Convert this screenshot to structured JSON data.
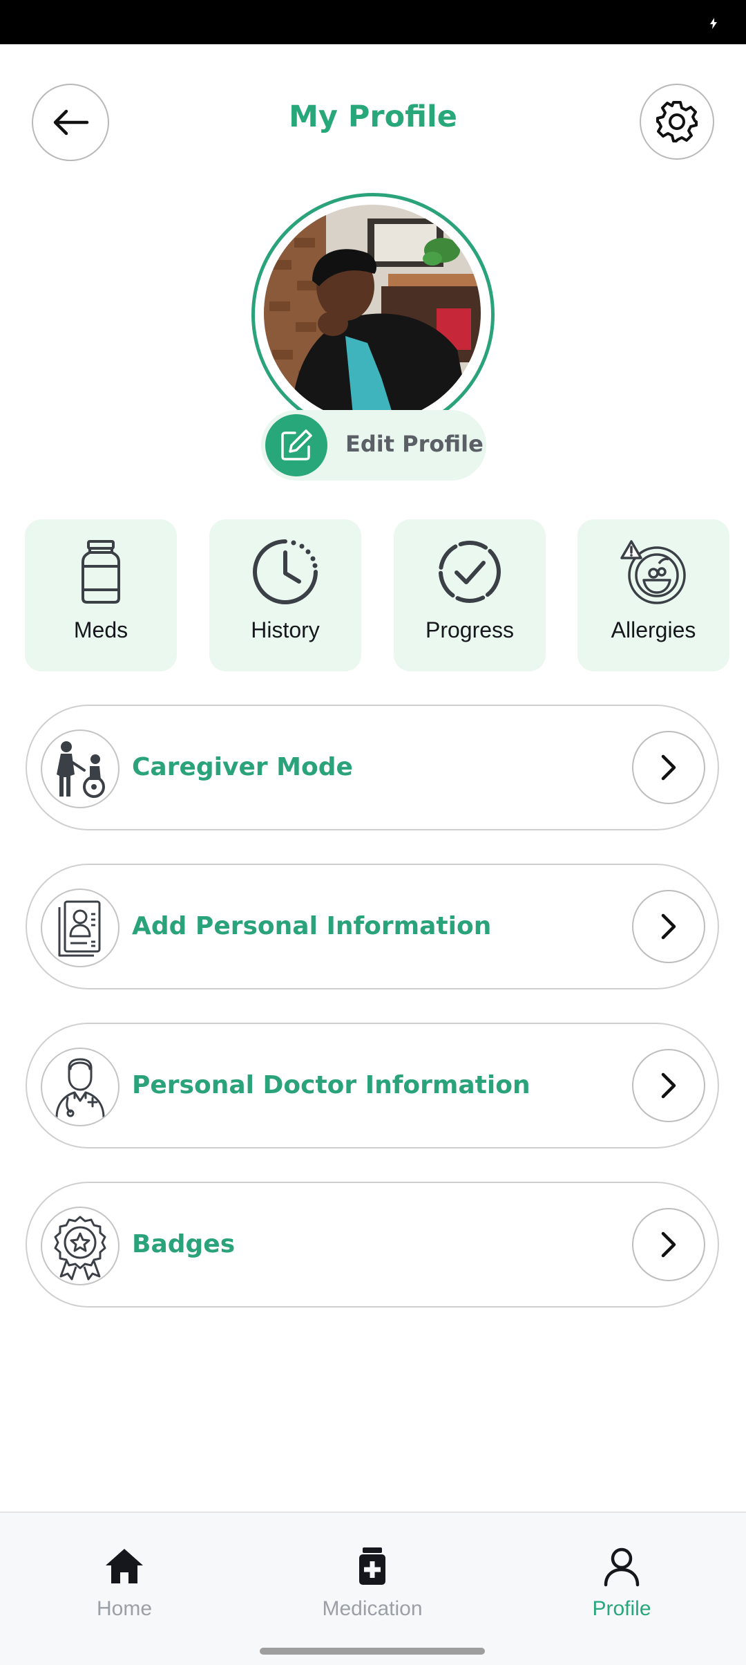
{
  "header": {
    "title": "My Profile",
    "back_icon": "arrow-left-icon",
    "settings_icon": "gear-icon"
  },
  "profile": {
    "avatar": "user-avatar-photo",
    "edit_label": "Edit Profile",
    "edit_icon": "pencil-square-icon"
  },
  "quick_actions": [
    {
      "label": "Meds",
      "icon": "medicine-bottle-icon"
    },
    {
      "label": "History",
      "icon": "clock-history-icon"
    },
    {
      "label": "Progress",
      "icon": "check-circle-dashed-icon"
    },
    {
      "label": "Allergies",
      "icon": "allergy-food-warning-icon"
    }
  ],
  "menu": [
    {
      "label": "Caregiver Mode",
      "icon": "caregiver-wheelchair-icon"
    },
    {
      "label": "Add Personal Information",
      "icon": "personal-id-card-icon"
    },
    {
      "label": "Personal Doctor Information",
      "icon": "doctor-icon"
    },
    {
      "label": "Badges",
      "icon": "badge-star-icon"
    }
  ],
  "bottom_nav": {
    "items": [
      {
        "label": "Home",
        "icon": "home-icon"
      },
      {
        "label": "Medication",
        "icon": "medication-icon"
      },
      {
        "label": "Profile",
        "icon": "profile-person-icon"
      }
    ],
    "active": "Profile"
  },
  "colors": {
    "brand_green": "#27a77a",
    "card_bg": "#ebf8ef",
    "text_dark": "#15171c",
    "muted_gray": "#9aa0a6"
  }
}
